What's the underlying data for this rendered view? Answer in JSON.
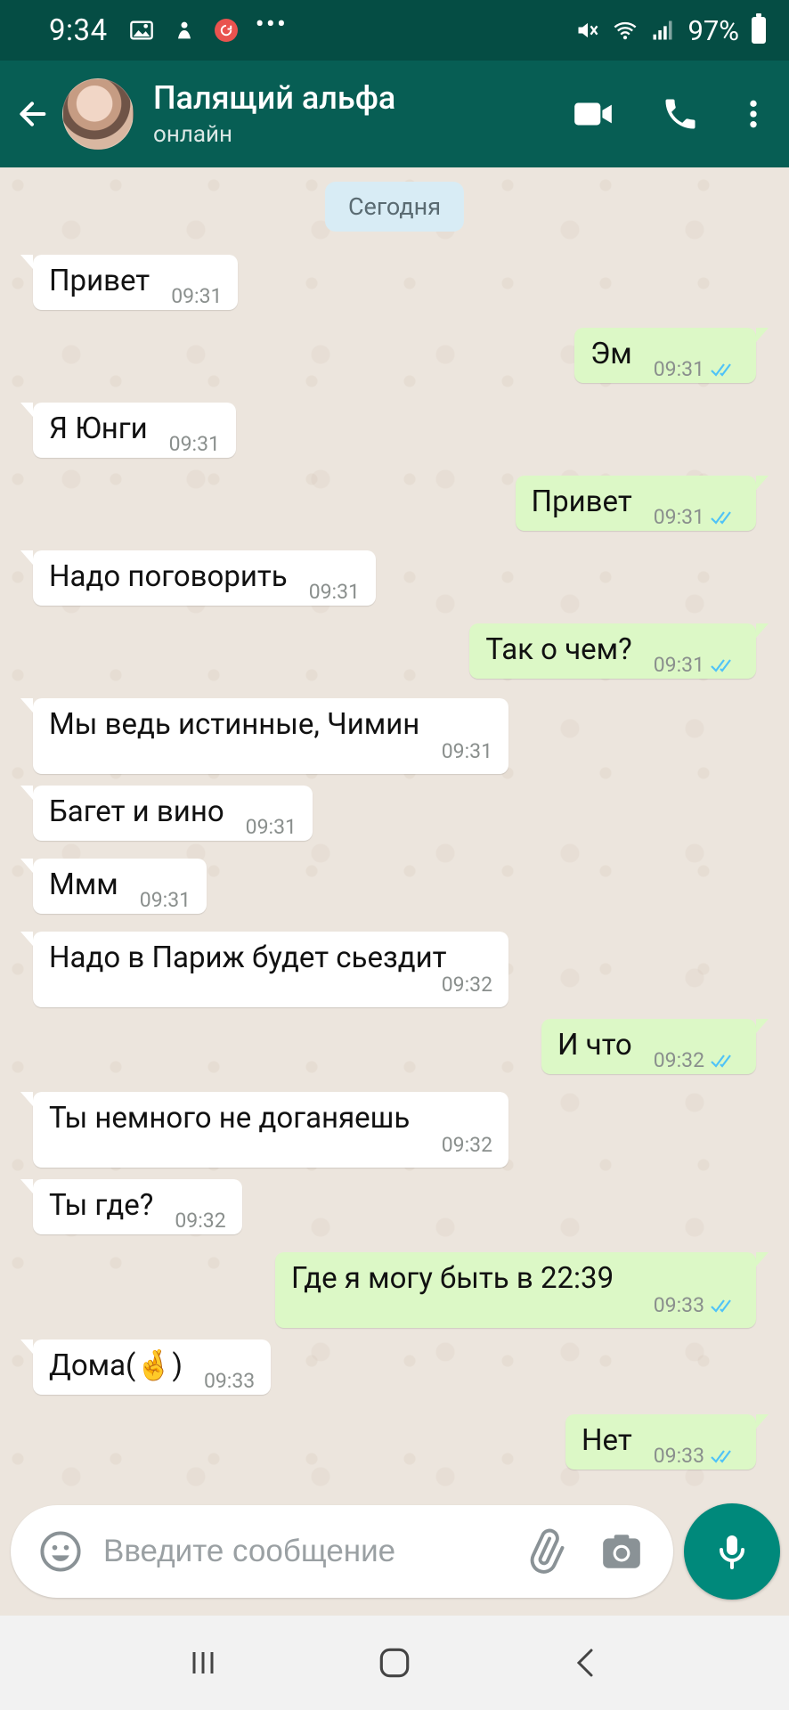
{
  "status_bar": {
    "time": "9:34",
    "dots": "•••",
    "battery": "97%"
  },
  "header": {
    "contact_name": "Палящий альфа",
    "status": "онлайн"
  },
  "chat": {
    "date_chip": "Сегодня",
    "messages": [
      {
        "dir": "in",
        "text": "Привет",
        "time": "09:31"
      },
      {
        "dir": "out",
        "text": "Эм",
        "time": "09:31"
      },
      {
        "dir": "in",
        "text": "Я Юнги",
        "time": "09:31"
      },
      {
        "dir": "out",
        "text": "Привет",
        "time": "09:31"
      },
      {
        "dir": "in",
        "text": "Надо поговорить",
        "time": "09:31"
      },
      {
        "dir": "out",
        "text": "Так о чем?",
        "time": "09:31"
      },
      {
        "dir": "in",
        "text": "Мы ведь истинные, Чимин",
        "time": "09:31"
      },
      {
        "dir": "in",
        "text": "Багет и вино",
        "time": "09:31"
      },
      {
        "dir": "in",
        "text": "Ммм",
        "time": "09:31"
      },
      {
        "dir": "in",
        "text": "Надо в Париж будет сьездит",
        "time": "09:32"
      },
      {
        "dir": "out",
        "text": "И что",
        "time": "09:32"
      },
      {
        "dir": "in",
        "text": "Ты немного не доганяешь",
        "time": "09:32"
      },
      {
        "dir": "in",
        "text": "Ты где?",
        "time": "09:32"
      },
      {
        "dir": "out",
        "text": "Где я могу быть в 22:39",
        "time": "09:33"
      },
      {
        "dir": "in",
        "text": "Дома(🤞)",
        "time": "09:33"
      },
      {
        "dir": "out",
        "text": "Нет",
        "time": "09:33"
      }
    ]
  },
  "composer": {
    "placeholder": "Введите сообщение"
  },
  "colors": {
    "header": "#075e54",
    "status_bar": "#054d44",
    "outgoing_bubble": "#dcf8c6",
    "incoming_bubble": "#ffffff",
    "chat_background": "#ece5dd",
    "mic_button": "#00897b",
    "read_ticks": "#4fc3f7"
  },
  "icons": {
    "back": "arrow-left-icon",
    "video": "video-camera-icon",
    "call": "phone-icon",
    "menu": "more-vertical-icon",
    "emoji": "emoji-icon",
    "attach": "paperclip-icon",
    "camera": "camera-icon",
    "mic": "microphone-icon"
  }
}
